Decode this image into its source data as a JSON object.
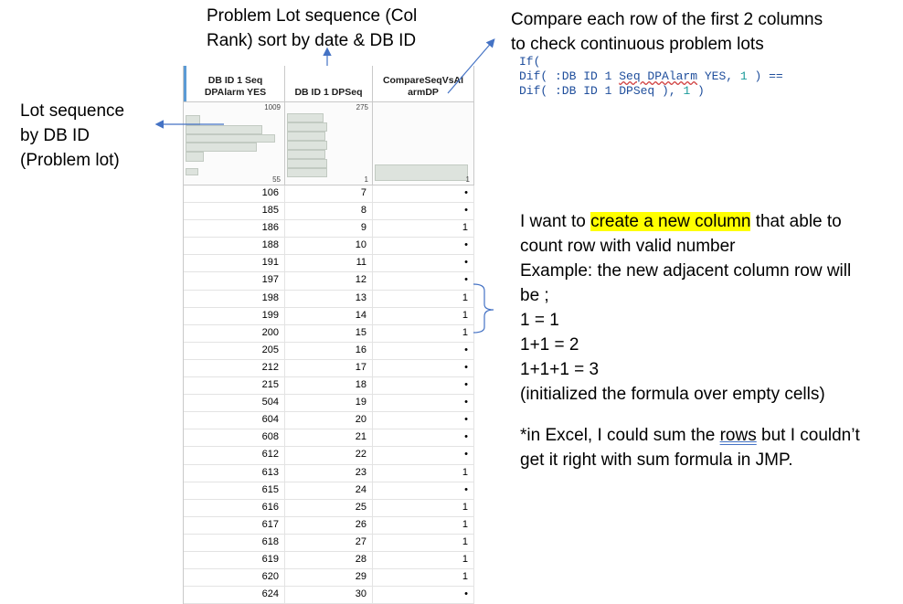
{
  "annotations": {
    "top_mid": [
      "Problem Lot sequence (Col",
      "Rank) sort by date & DB ID"
    ],
    "top_right": [
      "Compare each row of the first 2 columns",
      "to check continuous problem lots"
    ],
    "left": [
      "Lot sequence",
      "by DB ID",
      "(Problem lot)"
    ],
    "main": {
      "line1_pre": "I want to ",
      "line1_highlight": "create a new column",
      "line1_post": " that able to",
      "lines": [
        "count row with valid number",
        "Example: the new adjacent column row will",
        "be ;",
        "1 = 1",
        "1+1 = 2",
        "1+1+1 = 3",
        "(initialized the formula over empty cells)"
      ],
      "excel_pre": "*in Excel, I could sum the ",
      "excel_link": "rows",
      "excel_post": " but I couldn’t",
      "excel_line2": "get it right with sum formula in JMP."
    }
  },
  "formula": {
    "line1": "If(",
    "line2_pre": "Dif( :DB ID 1 ",
    "line2_squiggle": "Seq DPAlarm",
    "line2_mid": " YES, ",
    "line2_num": "1",
    "line2_post": " ) ==",
    "line3_pre": "Dif( :DB ID 1 DPSeq ), ",
    "line3_num": "1",
    "line3_post": " )"
  },
  "table": {
    "columns": [
      {
        "line1": "DB ID 1 Seq",
        "line2": "DPAlarm YES"
      },
      {
        "line1": "DB ID 1 DPSeq",
        "line2": ""
      },
      {
        "line1": "CompareSeqVsAl",
        "line2": "armDP"
      }
    ],
    "summary": {
      "col1": {
        "max": "1009",
        "min": "55"
      },
      "col2": {
        "max": "275",
        "min": "1"
      },
      "col3": {
        "max": "",
        "min": "1"
      }
    },
    "rows": [
      [
        "106",
        "7",
        "•"
      ],
      [
        "185",
        "8",
        "•"
      ],
      [
        "186",
        "9",
        "1"
      ],
      [
        "188",
        "10",
        "•"
      ],
      [
        "191",
        "11",
        "•"
      ],
      [
        "197",
        "12",
        "•"
      ],
      [
        "198",
        "13",
        "1"
      ],
      [
        "199",
        "14",
        "1"
      ],
      [
        "200",
        "15",
        "1"
      ],
      [
        "205",
        "16",
        "•"
      ],
      [
        "212",
        "17",
        "•"
      ],
      [
        "215",
        "18",
        "•"
      ],
      [
        "504",
        "19",
        "•"
      ],
      [
        "604",
        "20",
        "•"
      ],
      [
        "608",
        "21",
        "•"
      ],
      [
        "612",
        "22",
        "•"
      ],
      [
        "613",
        "23",
        "1"
      ],
      [
        "615",
        "24",
        "•"
      ],
      [
        "616",
        "25",
        "1"
      ],
      [
        "617",
        "26",
        "1"
      ],
      [
        "618",
        "27",
        "1"
      ],
      [
        "619",
        "28",
        "1"
      ],
      [
        "620",
        "29",
        "1"
      ],
      [
        "624",
        "30",
        "•"
      ]
    ]
  }
}
